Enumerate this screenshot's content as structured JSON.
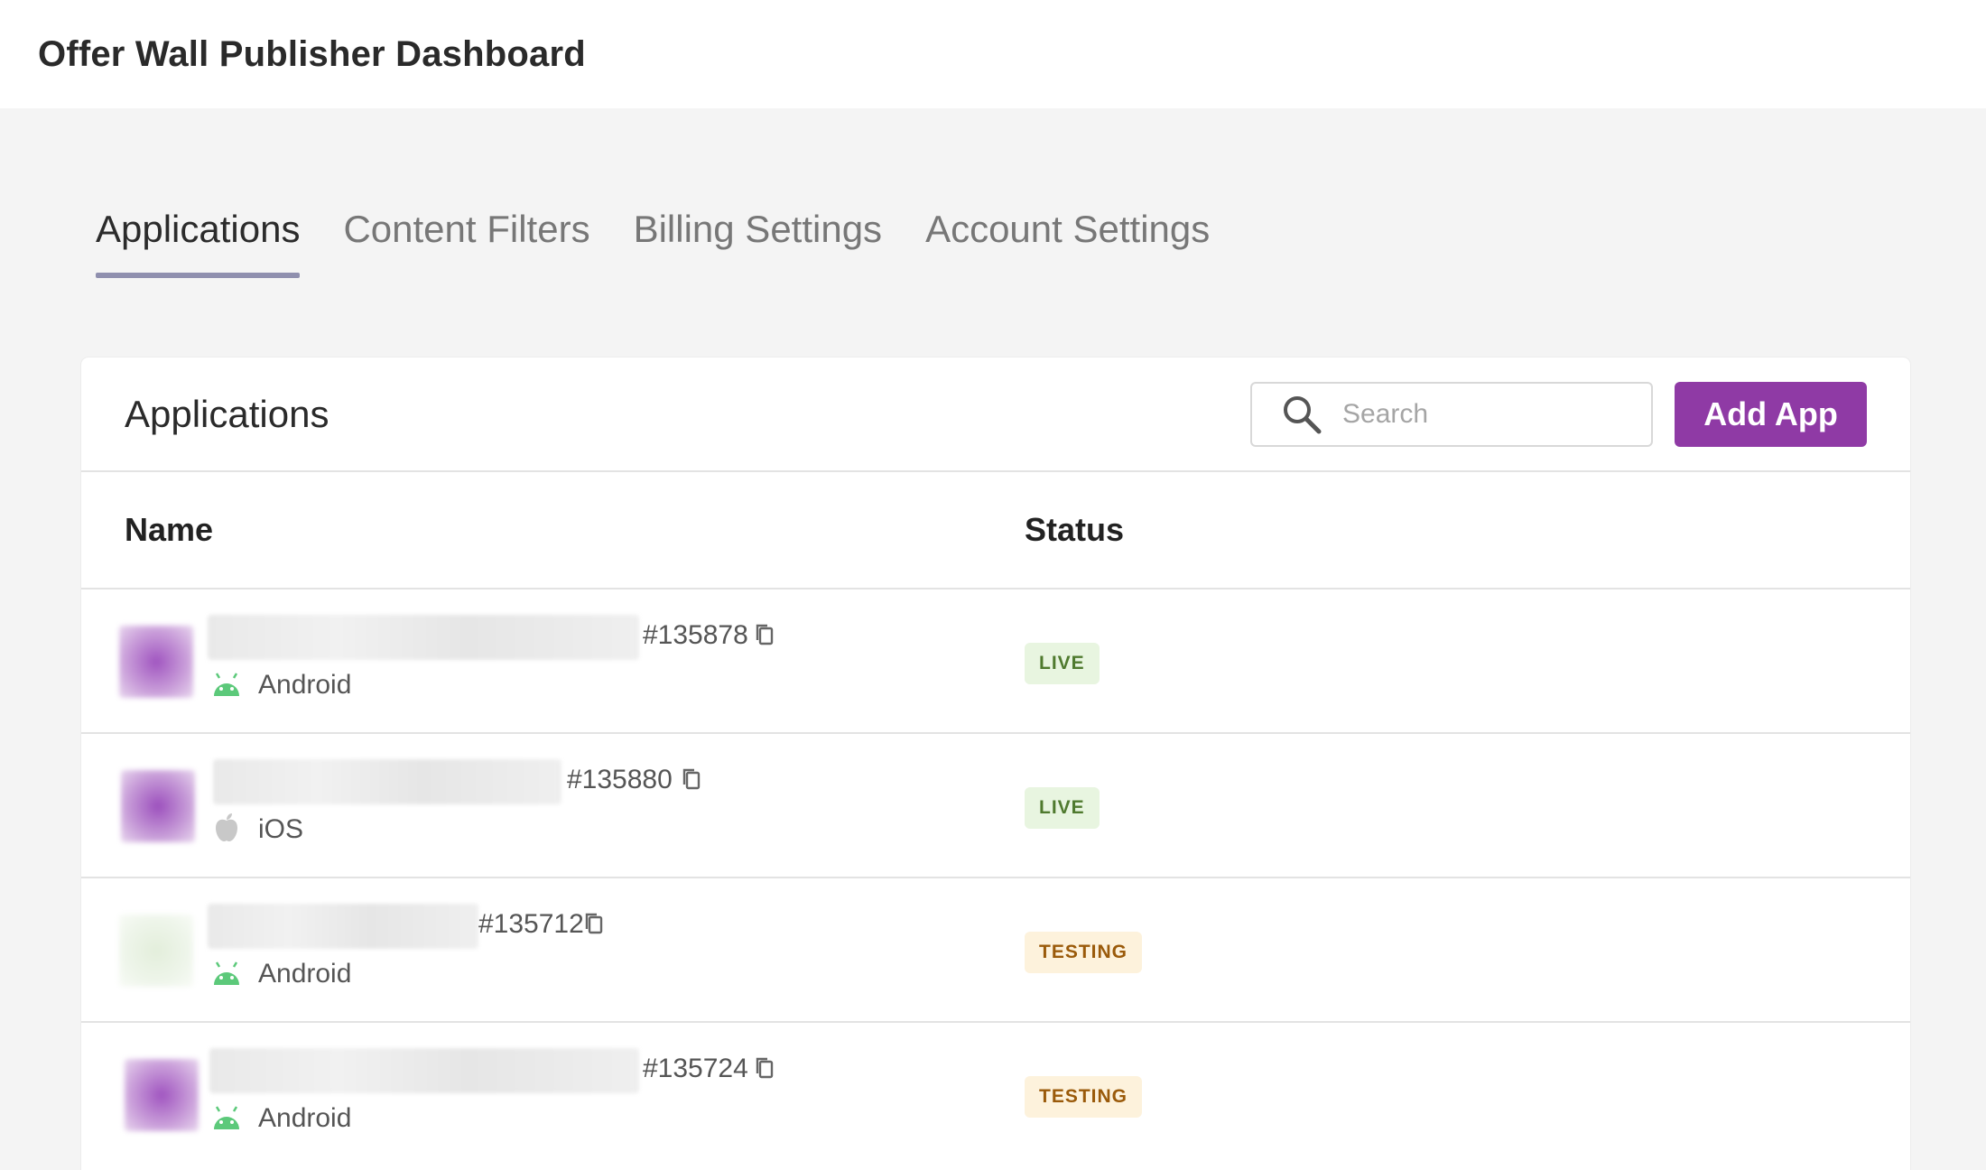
{
  "header": {
    "title": "Offer Wall Publisher Dashboard"
  },
  "tabs": [
    {
      "label": "Applications",
      "active": true
    },
    {
      "label": "Content Filters",
      "active": false
    },
    {
      "label": "Billing Settings",
      "active": false
    },
    {
      "label": "Account Settings",
      "active": false
    }
  ],
  "panel": {
    "title": "Applications",
    "search": {
      "placeholder": "Search",
      "value": ""
    },
    "add_button": "Add App",
    "columns": {
      "name": "Name",
      "status": "Status"
    },
    "rows": [
      {
        "id": "#135878",
        "platform": "Android",
        "platform_icon": "android-icon",
        "status": "LIVE"
      },
      {
        "id": "#135880",
        "platform": "iOS",
        "platform_icon": "apple-icon",
        "status": "LIVE"
      },
      {
        "id": "#135712",
        "platform": "Android",
        "platform_icon": "android-icon",
        "status": "TESTING"
      },
      {
        "id": "#135724",
        "platform": "Android",
        "platform_icon": "android-icon",
        "status": "TESTING"
      }
    ]
  },
  "colors": {
    "accent": "#8f3aa5",
    "tab_underline": "#8f8fae",
    "live_bg": "#e8f5e0",
    "live_text": "#4f7a2e",
    "testing_bg": "#fdf2dc",
    "testing_text": "#9a5a0a",
    "android_green": "#5cc97a"
  }
}
